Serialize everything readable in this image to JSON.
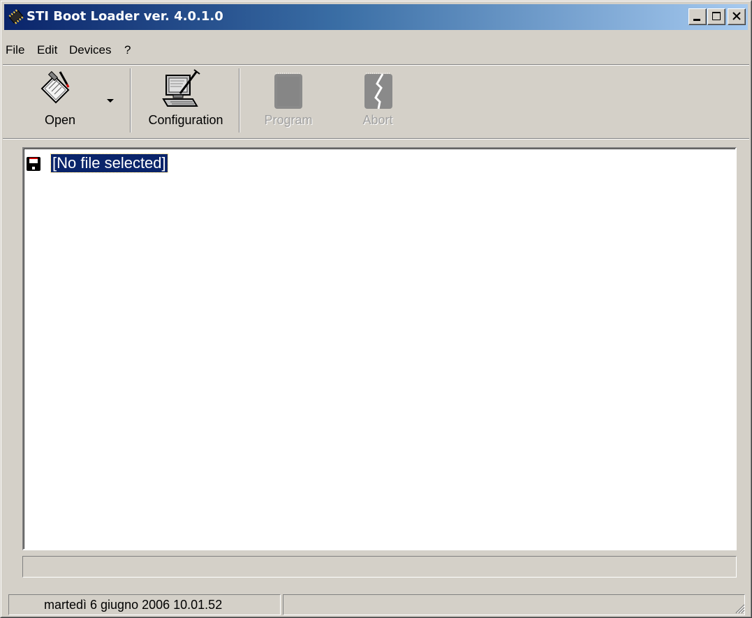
{
  "window": {
    "title": "STI Boot Loader ver. 4.0.1.0",
    "controls": [
      "minimize",
      "maximize",
      "close"
    ]
  },
  "menu": {
    "items": [
      {
        "label": "File"
      },
      {
        "label": "Edit"
      },
      {
        "label": "Devices"
      },
      {
        "label": "?"
      }
    ]
  },
  "toolbar": {
    "open": {
      "label": "Open",
      "icon": "open-clipboard-icon",
      "enabled": true
    },
    "configuration": {
      "label": "Configuration",
      "icon": "computer-configuration-icon",
      "enabled": true
    },
    "program": {
      "label": "Program",
      "icon": "chip-program-icon",
      "enabled": false
    },
    "abort": {
      "label": "Abort",
      "icon": "broken-chip-abort-icon",
      "enabled": false
    }
  },
  "file_tree": {
    "items": [
      {
        "label": "[No file selected]",
        "icon": "floppy-disk-icon",
        "selected": true
      }
    ]
  },
  "progress": {
    "value": 0
  },
  "statusbar": {
    "datetime": "martedì 6 giugno 2006 10.01.52",
    "second_pane": ""
  },
  "colors": {
    "title_start": "#0a246a",
    "title_end": "#a6caf0",
    "selection": "#0a246a",
    "face": "#d4d0c8"
  }
}
